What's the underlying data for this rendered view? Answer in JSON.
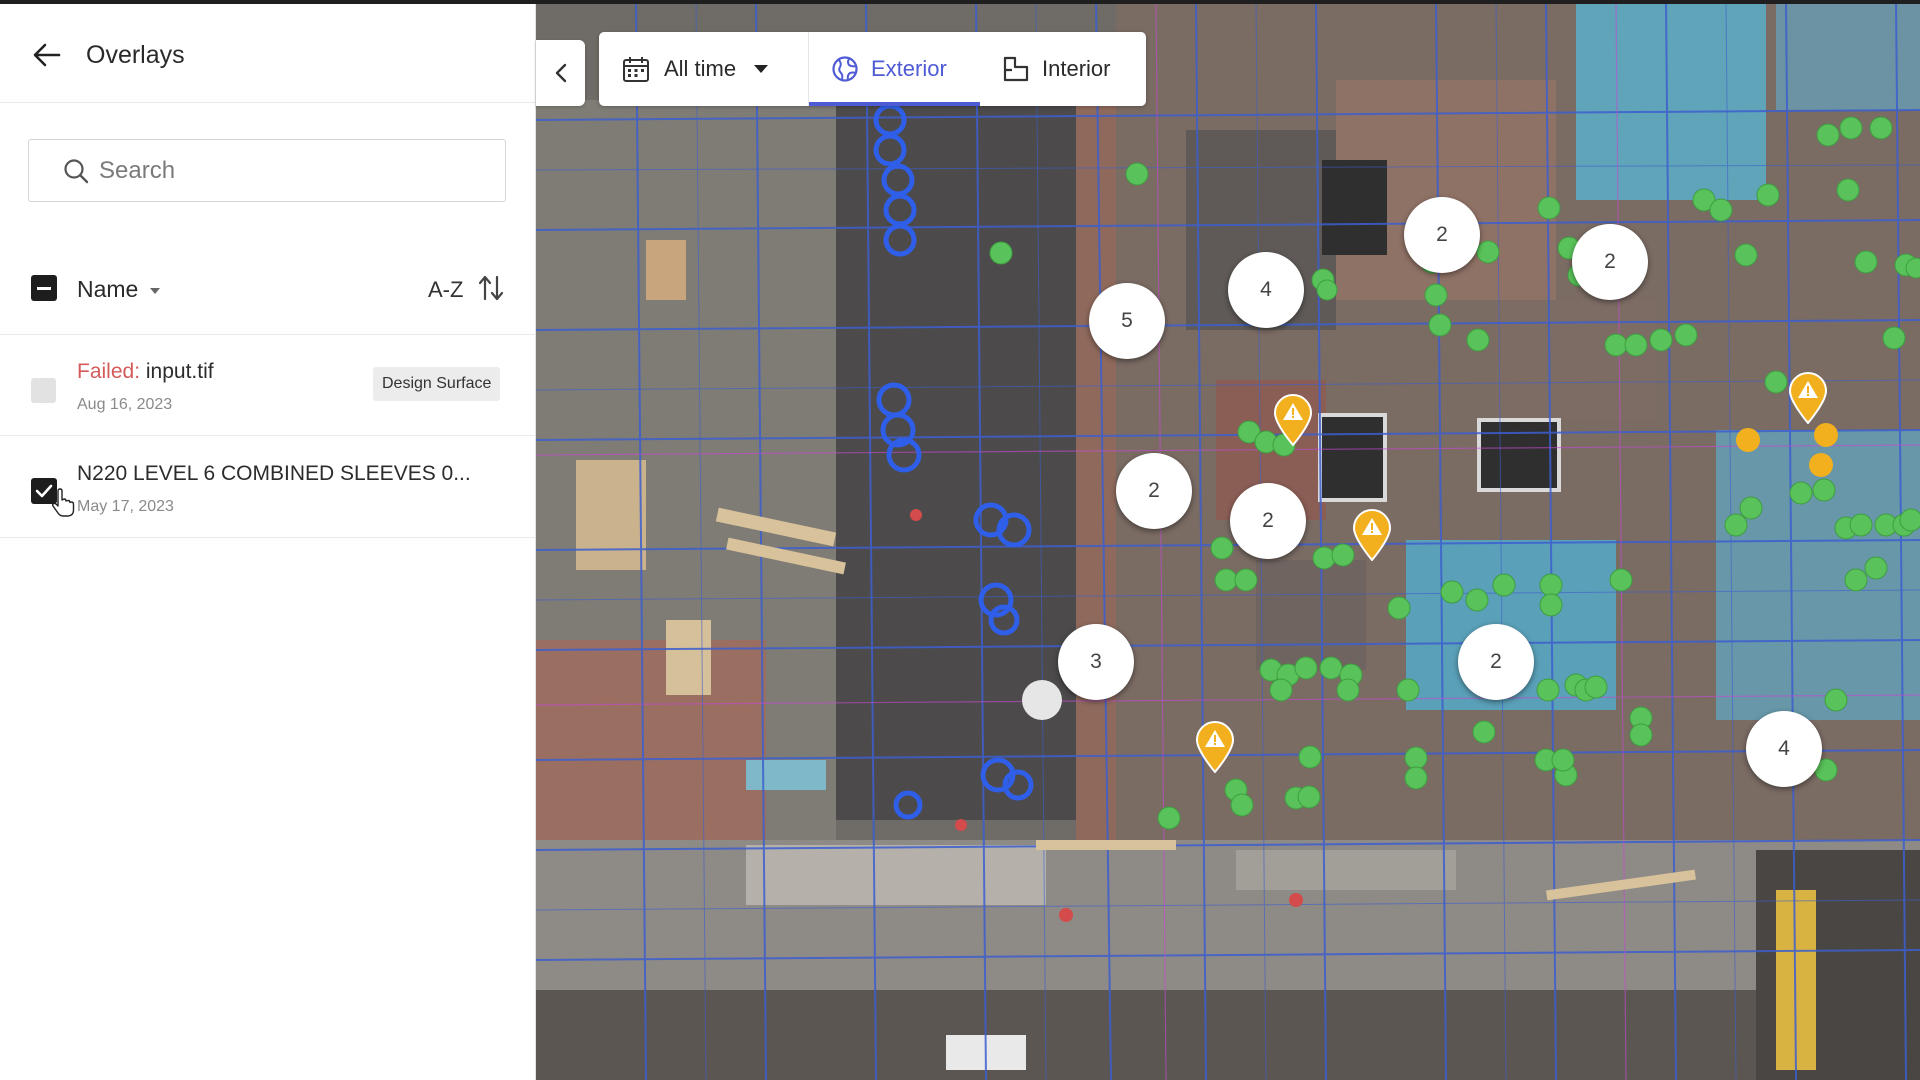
{
  "panel": {
    "title": "Overlays",
    "search_placeholder": "Search",
    "column_name": "Name",
    "sort_label": "A-Z",
    "items": [
      {
        "status": "Failed:",
        "name": "input.tif",
        "date": "Aug 16, 2023",
        "badge": "Design Surface",
        "checked": false
      },
      {
        "name": "N220 LEVEL 6 COMBINED SLEEVES 0...",
        "date": "May 17, 2023",
        "checked": true
      }
    ]
  },
  "toolbar": {
    "time_filter": "All time",
    "tabs": [
      {
        "label": "Exterior",
        "active": true
      },
      {
        "label": "Interior",
        "active": false
      }
    ]
  },
  "map": {
    "clusters": [
      "2",
      "2",
      "4",
      "5",
      "2",
      "2",
      "3",
      "2",
      "4"
    ],
    "warning_count": 4
  },
  "colors": {
    "accent": "#4f5bd5",
    "failed": "#d35b5b",
    "marker_green": "#59c25a",
    "marker_warning": "#f2b01e"
  }
}
